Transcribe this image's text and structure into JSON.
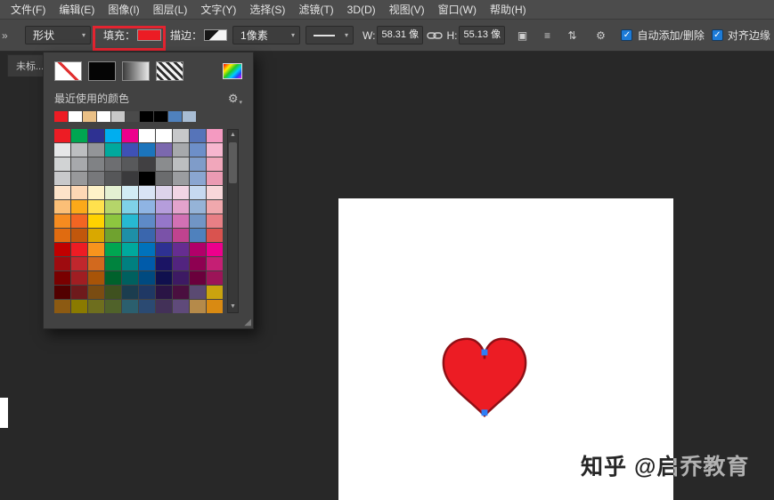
{
  "menu_bar": {
    "items": [
      "文件(F)",
      "编辑(E)",
      "图像(I)",
      "图层(L)",
      "文字(Y)",
      "选择(S)",
      "滤镜(T)",
      "3D(D)",
      "视图(V)",
      "窗口(W)",
      "帮助(H)"
    ]
  },
  "options_bar": {
    "tool_mode": "形状",
    "fill_label": "填充：",
    "stroke_label": "描边：",
    "stroke_width_value": "1像素",
    "w_label": "W:",
    "w_value": "58.31 像",
    "h_label": "H:",
    "h_value": "55.13 像",
    "auto_add_label": "自动添加/删除",
    "align_edges_label": "对齐边缘"
  },
  "tab_bar": {
    "active_tab": "未标..."
  },
  "fill_picker": {
    "recent_label": "最近使用的颜色",
    "recent_colors": [
      "#ed1c24",
      "#ffffff",
      "#eac086",
      "#ffffff",
      "#c8c8c8",
      "#4a4a4a",
      "#000000",
      "#000000",
      "#4f81bd",
      "#a8bdd4"
    ],
    "swatch_rows": [
      [
        "#ed1c24",
        "#00a651",
        "#2e3192",
        "#00aeef",
        "#ec008c",
        "#ffffff",
        "#ffffff",
        "#c7c8ca",
        "#5674b9",
        "#f49ac1"
      ],
      [
        "#e6e7e8",
        "#bcbec0",
        "#939598",
        "#00a99d",
        "#3f51b5",
        "#1c75bc",
        "#7b68ae",
        "#a7a9ac",
        "#6d8fc9",
        "#f7b6cf"
      ],
      [
        "#d1d3d4",
        "#a7a9ac",
        "#808285",
        "#6d6e71",
        "#58595b",
        "#414042",
        "#8a8c8e",
        "#bcbec0",
        "#7f9cc9",
        "#f1a7bb"
      ],
      [
        "#c8c9cb",
        "#98999b",
        "#77787b",
        "#565759",
        "#3a3a3c",
        "#000000",
        "#6b6c6e",
        "#9b9da0",
        "#8aa6d1",
        "#eb9bb3"
      ],
      [
        "#fde3c9",
        "#fdd7b4",
        "#fef2c8",
        "#e4f0d2",
        "#d2ecf4",
        "#d9e4f5",
        "#ddd3ea",
        "#f2d5e5",
        "#c6d9f0",
        "#f8d7da"
      ],
      [
        "#fbbf77",
        "#fba919",
        "#ffe14d",
        "#b5d56a",
        "#7fd1e7",
        "#8fb4e3",
        "#b59ddb",
        "#e3a3cc",
        "#95b3d7",
        "#f0a8ad"
      ],
      [
        "#f68b1f",
        "#f26522",
        "#ffd200",
        "#8dc63f",
        "#27b9d1",
        "#5e8ac7",
        "#9577c9",
        "#d271b4",
        "#7195c5",
        "#e87f85"
      ],
      [
        "#e06b10",
        "#c1570c",
        "#d9a800",
        "#6fa22f",
        "#1e8fa7",
        "#3a66ad",
        "#7a52a8",
        "#c0438f",
        "#4f81bd",
        "#d9534f"
      ],
      [
        "#c00000",
        "#ed1c24",
        "#f7941d",
        "#00a651",
        "#00a99d",
        "#0072bc",
        "#2e3192",
        "#662d91",
        "#b10069",
        "#ec008c"
      ],
      [
        "#9e0b0f",
        "#c1272d",
        "#d2691e",
        "#00833e",
        "#008080",
        "#005baa",
        "#1b1464",
        "#52247f",
        "#8e0051",
        "#c51f74"
      ],
      [
        "#790000",
        "#a01e22",
        "#a85408",
        "#00612c",
        "#00605f",
        "#004a80",
        "#10104e",
        "#3d1a63",
        "#6a003c",
        "#9c1458"
      ],
      [
        "#520000",
        "#6e1a1c",
        "#7a4c12",
        "#3f511f",
        "#1b3d4f",
        "#1f3864",
        "#2a1445",
        "#4a0f3f",
        "#5a4a72",
        "#caa30e"
      ],
      [
        "#8c5a12",
        "#8a7a00",
        "#6e6e1e",
        "#50622a",
        "#2b5f6e",
        "#2b4a72",
        "#433158",
        "#5f4a7a",
        "#b58a4a",
        "#d98a12"
      ]
    ]
  },
  "canvas": {
    "shape": {
      "type": "heart",
      "fill": "#ec1c24",
      "stroke": "#8e1016"
    }
  },
  "watermark": "知乎 @启乔教育",
  "colors": {
    "fill_swatch": "#ec1c24",
    "annotation": "#e42430",
    "checkbox": "#1d7bd7",
    "anchor": "#2f7ef6"
  },
  "icons": {
    "chevrons": "»",
    "dropdown_arrow": "▾",
    "gear": "⚙",
    "scroll_up": "▲",
    "scroll_down": "▼",
    "resize_grip": "◢",
    "check": "✓",
    "path_ops": "▣",
    "path_align": "≡",
    "path_arrange": "⇅"
  }
}
